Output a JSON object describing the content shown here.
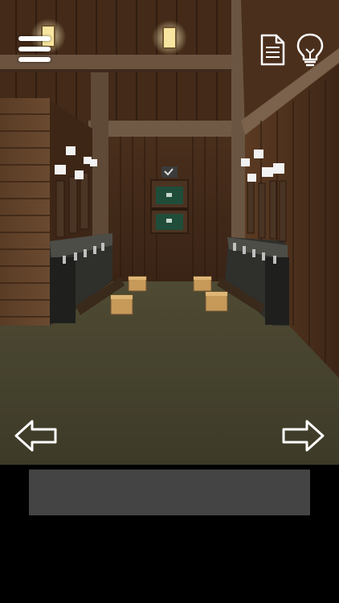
{
  "scene": {
    "name": "barn-washroom-view"
  },
  "hud": {
    "menu_icon": "hamburger-menu-icon",
    "memo_icon": "document-icon",
    "hint_icon": "lightbulb-icon",
    "icon_color": "#ffffff"
  },
  "navigation": {
    "left_icon": "arrow-left-icon",
    "right_icon": "arrow-right-icon"
  },
  "message": {
    "text": ""
  },
  "colors": {
    "wood_dark": "#3b2415",
    "wood_mid": "#5a3a22",
    "floor": "#4a4630",
    "message_bg": "#444444"
  }
}
